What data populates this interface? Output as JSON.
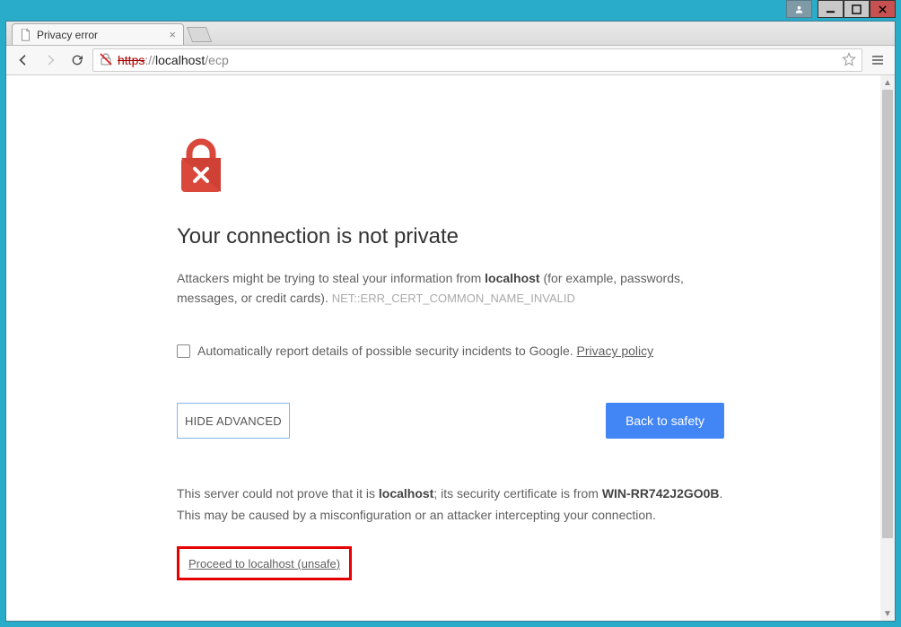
{
  "window": {
    "user_btn": "👤",
    "minimize": "—",
    "maximize": "▣",
    "close": "✕"
  },
  "tab": {
    "title": "Privacy error",
    "close": "×"
  },
  "address": {
    "scheme": "https",
    "sep": "://",
    "host": "localhost",
    "path": "/ecp"
  },
  "page": {
    "heading": "Your connection is not private",
    "warn_prefix": "Attackers might be trying to steal your information from ",
    "warn_host": "localhost",
    "warn_suffix": " (for example, passwords, messages, or credit cards). ",
    "error_code": "NET::ERR_CERT_COMMON_NAME_INVALID",
    "checkbox_label": "Automatically report details of possible security incidents to Google. ",
    "privacy_link": "Privacy policy",
    "hide_advanced": "HIDE ADVANCED",
    "back_safety": "Back to safety",
    "adv_p1a": "This server could not prove that it is ",
    "adv_host": "localhost",
    "adv_p1b": "; its security certificate is from ",
    "adv_cert": "WIN-RR742J2GO0B",
    "adv_p1c": ". This may be caused by a misconfiguration or an attacker intercepting your connection.",
    "proceed": "Proceed to localhost (unsafe)"
  }
}
